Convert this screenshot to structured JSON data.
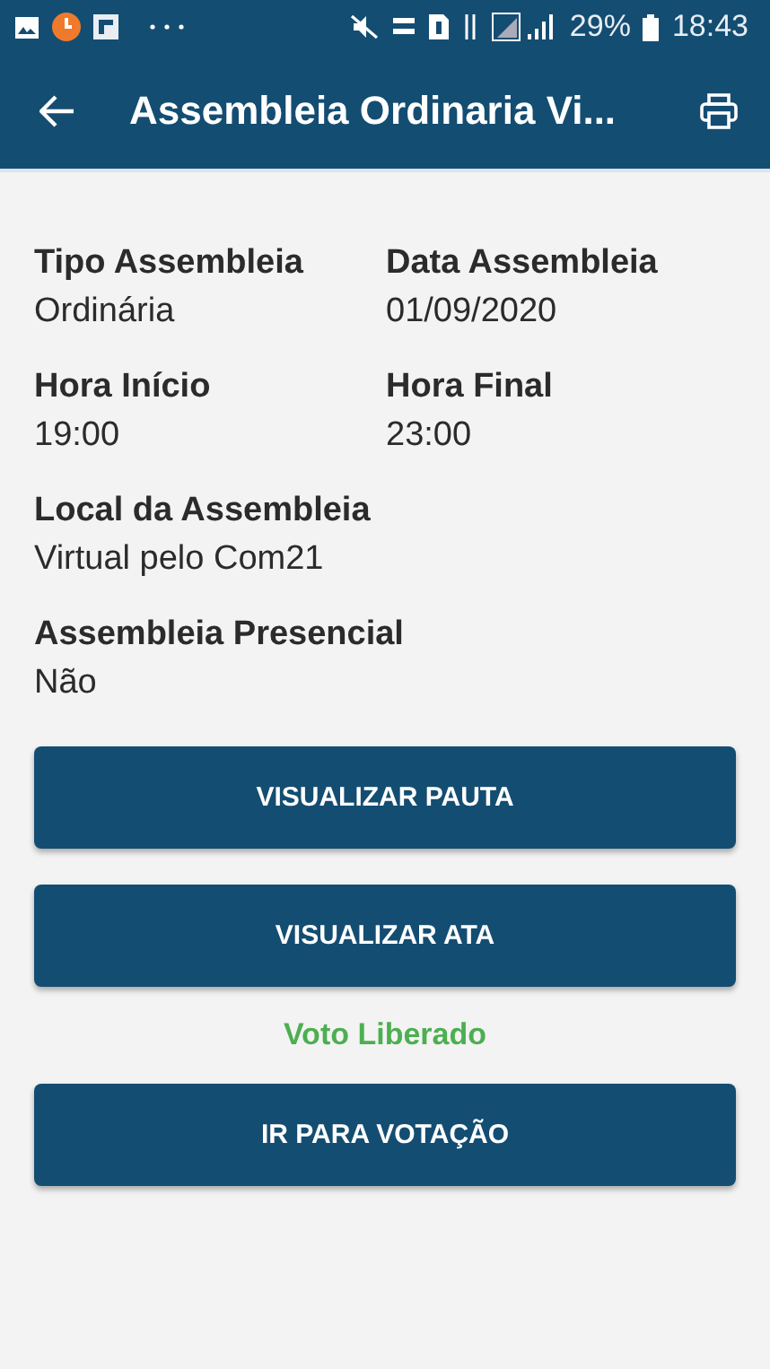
{
  "status_bar": {
    "battery": "29%",
    "time": "18:43"
  },
  "header": {
    "title": "Assembleia Ordinaria Vi..."
  },
  "field_rows": [
    [
      {
        "label": "Tipo Assembleia",
        "value": "Ordinária"
      },
      {
        "label": "Data Assembleia",
        "value": "01/09/2020"
      }
    ],
    [
      {
        "label": "Hora Início",
        "value": "19:00"
      },
      {
        "label": "Hora Final",
        "value": "23:00"
      }
    ],
    [
      {
        "label": "Local da Assembleia",
        "value": "Virtual pelo Com21"
      }
    ],
    [
      {
        "label": "Assembleia Presencial",
        "value": "Não"
      }
    ]
  ],
  "buttons": [
    {
      "kind": "button",
      "label": "VISUALIZAR PAUTA"
    },
    {
      "kind": "button",
      "label": "VISUALIZAR ATA"
    },
    {
      "kind": "status",
      "label": "Voto Liberado",
      "color": "#4caf50"
    },
    {
      "kind": "button",
      "label": "IR PARA VOTAÇÃO"
    }
  ]
}
